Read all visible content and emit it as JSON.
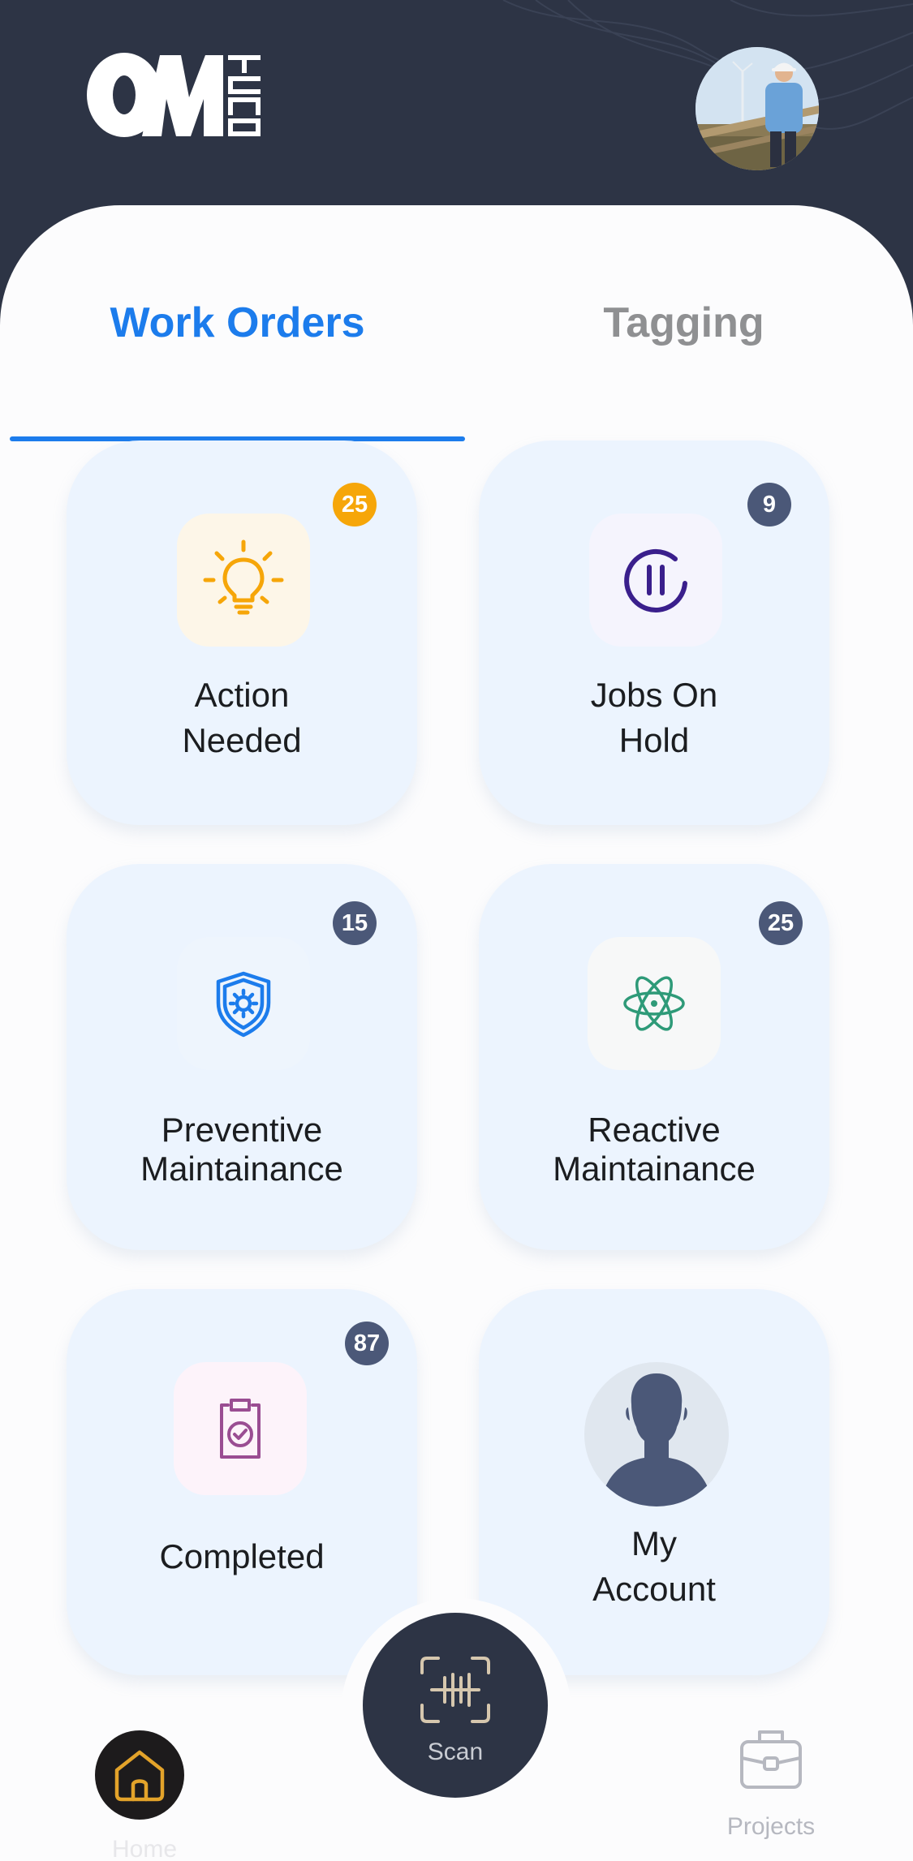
{
  "app": {
    "logo_text": "OM TECH"
  },
  "colors": {
    "header_bg": "#2d3445",
    "accent_blue": "#1c7cec",
    "card_bg": "#ecf4fe",
    "badge_orange": "#f6a609",
    "badge_slate": "#4b5878"
  },
  "tabs": [
    {
      "label": "Work Orders",
      "active": true
    },
    {
      "label": "Tagging",
      "active": false
    }
  ],
  "cards": {
    "action_needed": {
      "line1": "Action",
      "line2": "Needed",
      "badge": "25",
      "icon": "lightbulb-icon"
    },
    "jobs_on_hold": {
      "line1": "Jobs On",
      "line2": "Hold",
      "badge": "9",
      "icon": "pause-icon"
    },
    "preventive": {
      "line1": "Preventive",
      "line2": "Maintainance",
      "badge": "15",
      "icon": "shield-gear-icon"
    },
    "reactive": {
      "line1": "Reactive",
      "line2": "Maintainance",
      "badge": "25",
      "icon": "atom-icon"
    },
    "completed": {
      "line1": "Completed",
      "badge": "87",
      "icon": "clipboard-check-icon"
    },
    "my_account": {
      "line1": "My",
      "line2": "Account",
      "icon": "person-icon"
    }
  },
  "bottom_nav": {
    "home": {
      "label": "Home",
      "icon": "home-icon",
      "active": true
    },
    "scan": {
      "label": "Scan",
      "icon": "scan-icon"
    },
    "projects": {
      "label": "Projects",
      "icon": "briefcase-icon"
    }
  }
}
